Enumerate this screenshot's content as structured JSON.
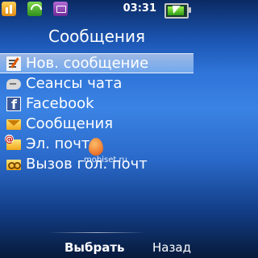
{
  "status_bar": {
    "time": "03:31",
    "icons": [
      "gprs-icon",
      "wifi-icon",
      "message-icon",
      "battery-charging-icon"
    ]
  },
  "title": "Сообщения",
  "menu": {
    "items": [
      {
        "label": "Нов. сообщение",
        "icon": "compose-icon",
        "selected": true
      },
      {
        "label": "Сеансы чата",
        "icon": "chat-bubble-icon",
        "selected": false
      },
      {
        "label": "Facebook",
        "icon": "facebook-icon",
        "selected": false
      },
      {
        "label": "Сообщения",
        "icon": "envelope-icon",
        "selected": false
      },
      {
        "label": "Эл. почта",
        "icon": "email-icon",
        "selected": false
      },
      {
        "label": "Вызов гол. почт",
        "icon": "voicemail-icon",
        "selected": false
      }
    ]
  },
  "watermark": "mobiset.ru",
  "softkeys": {
    "left": "Выбрать",
    "right": "Назад"
  },
  "colors": {
    "background_top": "#0b2a63",
    "background_mid": "#3a83e4",
    "background_bottom": "#071a3a",
    "highlight": "#b9d9ff"
  }
}
